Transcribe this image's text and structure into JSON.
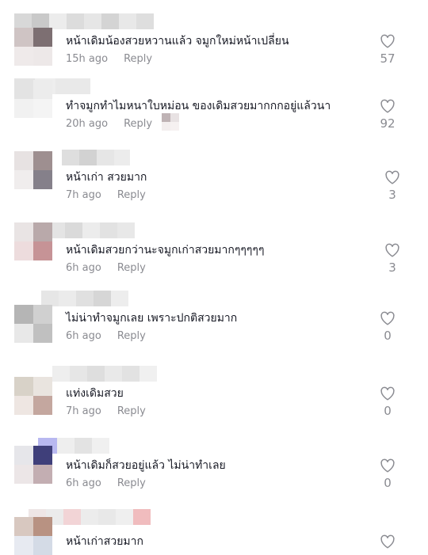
{
  "comments": [
    {
      "text": "หน้าเดิมน้องสวยหวานแล้ว จมูกใหม่หน้าเปลี่ยน",
      "time": "15h ago",
      "reply": "Reply",
      "likes": "57"
    },
    {
      "text": "ทำจมูกทำไมหนาใบหม่อน ของเดิมสวยมากกกอยู่แล้วนา",
      "time": "20h ago",
      "reply": "Reply",
      "likes": "92"
    },
    {
      "text": "หน้าเก่า สวยมาก",
      "time": "7h ago",
      "reply": "Reply",
      "likes": "3"
    },
    {
      "text": "หน้าเดิมสวยกว่านะจมูกเก่าสวยมากๆๆๆๆๆ",
      "time": "6h ago",
      "reply": "Reply",
      "likes": "3"
    },
    {
      "text": "ไม่น่าทำจมูกเลย เพราะปกติสวยมาก",
      "time": "6h ago",
      "reply": "Reply",
      "likes": "0"
    },
    {
      "text": "แท่งเดิมสวย",
      "time": "7h ago",
      "reply": "Reply",
      "likes": "0"
    },
    {
      "text": "หน้าเดิมก็สวยอยู่แล้ว ไม่น่าทำเลย",
      "time": "6h ago",
      "reply": "Reply",
      "likes": "0"
    },
    {
      "text": "หน้าเก่าสวยมาก",
      "time": "",
      "reply": "",
      "likes": ""
    }
  ],
  "icons": {
    "like": "heart-outline-icon"
  },
  "colors": {
    "text": "#161823",
    "muted": "#8a8b91"
  }
}
